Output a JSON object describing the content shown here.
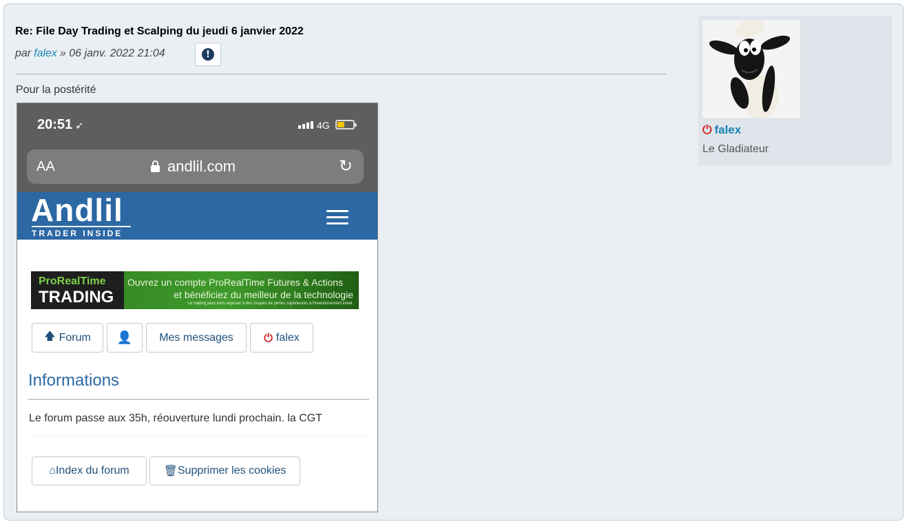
{
  "post": {
    "title": "Re: File Day Trading et Scalping du jeudi 6 janvier 2022",
    "meta_prefix": "par",
    "author": "falex",
    "meta_suffix": "» 06 janv. 2022 21:04",
    "report_icon": "exclamation-circle-icon",
    "body_text": "Pour la postérité"
  },
  "screenshot": {
    "status_time": "20:51",
    "status_arrow": "➶",
    "network": "4G",
    "url_aa": "AA",
    "url": "andlil.com",
    "reload_glyph": "↻",
    "logo": "Andlil",
    "logo_sub": "TRADER INSIDE",
    "banner": {
      "brand_top": "ProRealTime",
      "brand_bottom": "TRADING",
      "line1": "Ouvrez un compte ProRealTime Futures & Actions",
      "line2": "et bénéficiez du meilleur de la technologie",
      "line3": "Le trading peut vous exposer à des risques de pertes supérieures à l'investissement initial."
    },
    "nav_buttons": {
      "forum": "Forum",
      "messages": "Mes messages",
      "user": "falex"
    },
    "info_heading": "Informations",
    "info_text": "Le forum passe aux 35h, réouverture lundi prochain. la CGT",
    "footer_buttons": {
      "index": "Index du forum",
      "cookies": "Supprimer les cookies"
    }
  },
  "profile": {
    "username": "falex",
    "rank": "Le Gladiateur",
    "avatar_icon": "sheep-avatar",
    "status_icon": "power-icon"
  },
  "colors": {
    "author_link": "#1a86b7",
    "site_header": "#2c68a4",
    "power_red": "#cc2222"
  }
}
